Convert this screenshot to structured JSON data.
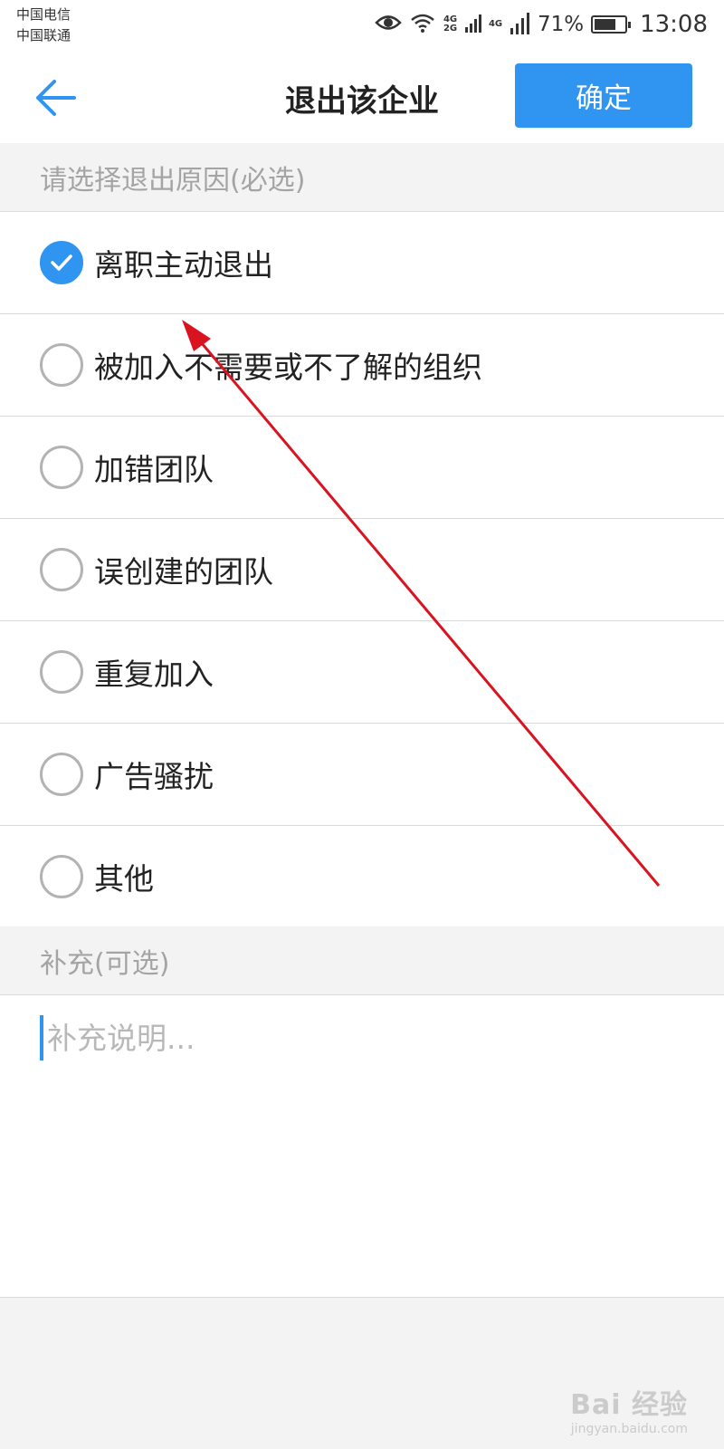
{
  "status_bar": {
    "carrier_1": "中国电信",
    "carrier_2": "中国联通",
    "net_1": "4G 2G",
    "net_2": "4G",
    "battery": "71%",
    "battery_level": 0.71,
    "time": "13:08"
  },
  "nav": {
    "title": "退出该企业",
    "confirm_label": "确定"
  },
  "reason_section": {
    "header": "请选择退出原因(必选)",
    "options": [
      {
        "label": "离职主动退出",
        "checked": true
      },
      {
        "label": "被加入不需要或不了解的组织",
        "checked": false
      },
      {
        "label": "加错团队",
        "checked": false
      },
      {
        "label": "误创建的团队",
        "checked": false
      },
      {
        "label": "重复加入",
        "checked": false
      },
      {
        "label": "广告骚扰",
        "checked": false
      },
      {
        "label": "其他",
        "checked": false
      }
    ]
  },
  "note_section": {
    "header": "补充(可选)",
    "placeholder": "补充说明...",
    "value": ""
  },
  "watermark": {
    "main": "Bai 经验",
    "sub": "jingyan.baidu.com"
  },
  "colors": {
    "accent": "#2f95f1",
    "annotation_arrow": "#d9131f"
  },
  "icons": {
    "back": "arrow-left-icon",
    "check": "check-icon",
    "eye": "eye-icon",
    "wifi": "wifi-icon",
    "signal": "signal-icon",
    "battery": "battery-icon"
  }
}
